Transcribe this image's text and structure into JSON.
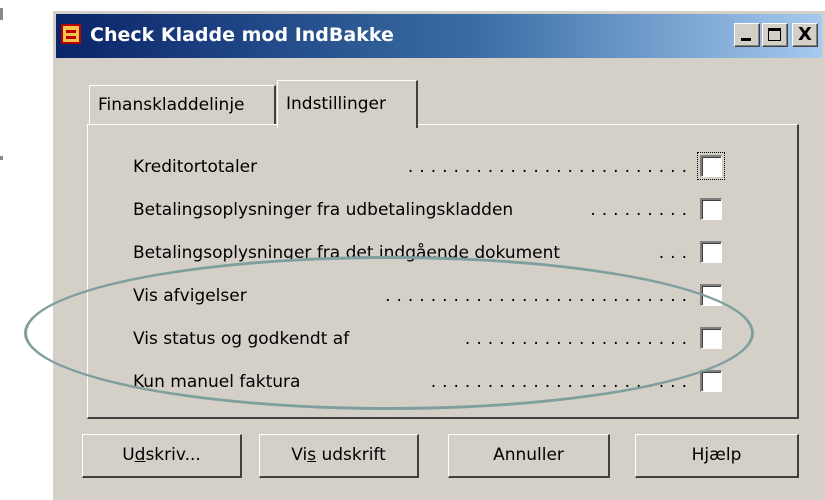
{
  "window": {
    "title": "Check Kladde mod IndBakke",
    "title_icon": "app-document-icon",
    "controls": {
      "minimize": "minimize-icon",
      "maximize": "maximize-icon",
      "close": "close-icon",
      "close_glyph": "X"
    }
  },
  "tabs": [
    {
      "label": "Finanskladdelinje",
      "active": false
    },
    {
      "label": "Indstillinger",
      "active": true
    }
  ],
  "options": [
    {
      "label": "Kreditortotaler",
      "checked": false
    },
    {
      "label": "Betalingsoplysninger fra udbetalingskladden",
      "checked": false
    },
    {
      "label": "Betalingsoplysninger fra det indgående dokument",
      "checked": false
    },
    {
      "label": "Vis afvigelser",
      "checked": false
    },
    {
      "label": "Vis status og godkendt af",
      "checked": false
    },
    {
      "label": "Kun manuel faktura",
      "checked": false
    }
  ],
  "buttons": {
    "print": {
      "pre": "U",
      "accel": "d",
      "post": "skriv..."
    },
    "preview": {
      "pre": "Vi",
      "accel": "s",
      "post": " udskrift"
    },
    "cancel": {
      "label": "Annuller"
    },
    "help": {
      "label": "Hjælp"
    }
  },
  "annotation": {
    "shape": "ellipse",
    "color": "#7f9f9f"
  },
  "colors": {
    "titlebar_start": "#0a246a",
    "titlebar_end": "#a6caf0",
    "face": "#d4d0c8"
  }
}
